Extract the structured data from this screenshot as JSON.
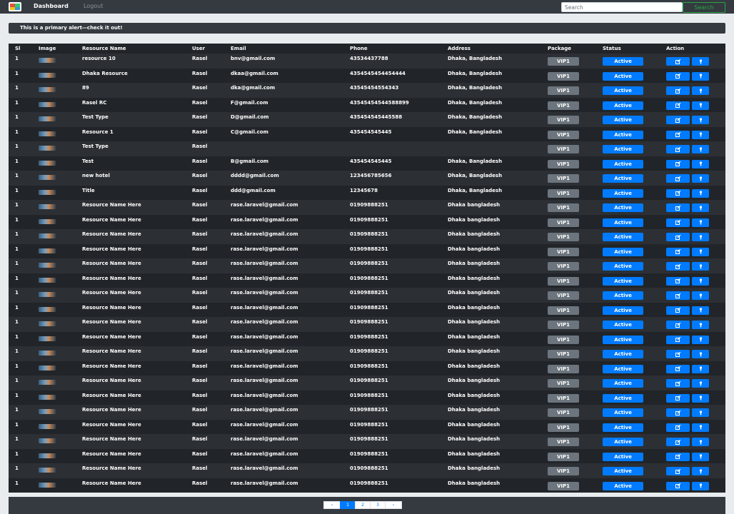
{
  "navbar": {
    "dashboard_label": "Dashboard",
    "logout_label": "Logout",
    "search_placeholder": "Search",
    "search_button": "Search"
  },
  "alert": {
    "text": "This is a primary alert—check it out!"
  },
  "table": {
    "headers": [
      "Sl",
      "Image",
      "Resource Name",
      "User",
      "Email",
      "Phone",
      "Address",
      "Package",
      "Status",
      "Action"
    ],
    "rows": [
      {
        "sl": "1",
        "name": "resource 10",
        "user": "Rasel",
        "email": "bnv@gmail.com",
        "phone": "43534437788",
        "address": "Dhaka, Bangladesh",
        "package": "VIP1",
        "status": "Active"
      },
      {
        "sl": "1",
        "name": "Dhaka Resource",
        "user": "Rasel",
        "email": "dkaa@gmail.com",
        "phone": "4354545454454444",
        "address": "Dhaka, Bangladesh",
        "package": "VIP1",
        "status": "Active"
      },
      {
        "sl": "1",
        "name": "89",
        "user": "Rasel",
        "email": "dka@gmail.com",
        "phone": "43545454554343",
        "address": "Dhaka, Bangladesh",
        "package": "VIP1",
        "status": "Active"
      },
      {
        "sl": "1",
        "name": "Rasel RC",
        "user": "Rasel",
        "email": "F@gmail.com",
        "phone": "43545454544588899",
        "address": "Dhaka, Bangladesh",
        "package": "VIP1",
        "status": "Active"
      },
      {
        "sl": "1",
        "name": "Test Type",
        "user": "Rasel",
        "email": "D@gmail.com",
        "phone": "435454545445588",
        "address": "Dhaka, Bangladesh",
        "package": "VIP1",
        "status": "Active"
      },
      {
        "sl": "1",
        "name": "Resource 1",
        "user": "Rasel",
        "email": "C@gmail.com",
        "phone": "435454545445",
        "address": "Dhaka, Bangladesh",
        "package": "VIP1",
        "status": "Active"
      },
      {
        "sl": "1",
        "name": "Test Type",
        "user": "Rasel",
        "email": "",
        "phone": "",
        "address": "",
        "package": "VIP1",
        "status": "Active"
      },
      {
        "sl": "1",
        "name": "Test",
        "user": "Rasel",
        "email": "B@gmail.com",
        "phone": "435454545445",
        "address": "Dhaka, Bangladesh",
        "package": "VIP1",
        "status": "Active"
      },
      {
        "sl": "1",
        "name": "new hotel",
        "user": "Rasel",
        "email": "dddd@gmail.com",
        "phone": "123456785656",
        "address": "Dhaka, Bangladesh",
        "package": "VIP1",
        "status": "Active"
      },
      {
        "sl": "1",
        "name": "Title",
        "user": "Rasel",
        "email": "ddd@gmail.com",
        "phone": "12345678",
        "address": "Dhaka, Bangladesh",
        "package": "VIP1",
        "status": "Active"
      },
      {
        "sl": "1",
        "name": "Resource Name Here",
        "user": "Rasel",
        "email": "rase.laravel@gmail.com",
        "phone": "01909888251",
        "address": "Dhaka bangladesh",
        "package": "VIP1",
        "status": "Active"
      },
      {
        "sl": "1",
        "name": "Resource Name Here",
        "user": "Rasel",
        "email": "rase.laravel@gmail.com",
        "phone": "01909888251",
        "address": "Dhaka bangladesh",
        "package": "VIP1",
        "status": "Active"
      },
      {
        "sl": "1",
        "name": "Resource Name Here",
        "user": "Rasel",
        "email": "rase.laravel@gmail.com",
        "phone": "01909888251",
        "address": "Dhaka bangladesh",
        "package": "VIP1",
        "status": "Active"
      },
      {
        "sl": "1",
        "name": "Resource Name Here",
        "user": "Rasel",
        "email": "rase.laravel@gmail.com",
        "phone": "01909888251",
        "address": "Dhaka bangladesh",
        "package": "VIP1",
        "status": "Active"
      },
      {
        "sl": "1",
        "name": "Resource Name Here",
        "user": "Rasel",
        "email": "rase.laravel@gmail.com",
        "phone": "01909888251",
        "address": "Dhaka bangladesh",
        "package": "VIP1",
        "status": "Active"
      },
      {
        "sl": "1",
        "name": "Resource Name Here",
        "user": "Rasel",
        "email": "rase.laravel@gmail.com",
        "phone": "01909888251",
        "address": "Dhaka bangladesh",
        "package": "VIP1",
        "status": "Active"
      },
      {
        "sl": "1",
        "name": "Resource Name Here",
        "user": "Rasel",
        "email": "rase.laravel@gmail.com",
        "phone": "01909888251",
        "address": "Dhaka bangladesh",
        "package": "VIP1",
        "status": "Active"
      },
      {
        "sl": "1",
        "name": "Resource Name Here",
        "user": "Rasel",
        "email": "rase.laravel@gmail.com",
        "phone": "01909888251",
        "address": "Dhaka bangladesh",
        "package": "VIP1",
        "status": "Active"
      },
      {
        "sl": "1",
        "name": "Resource Name Here",
        "user": "Rasel",
        "email": "rase.laravel@gmail.com",
        "phone": "01909888251",
        "address": "Dhaka bangladesh",
        "package": "VIP1",
        "status": "Active"
      },
      {
        "sl": "1",
        "name": "Resource Name Here",
        "user": "Rasel",
        "email": "rase.laravel@gmail.com",
        "phone": "01909888251",
        "address": "Dhaka bangladesh",
        "package": "VIP1",
        "status": "Active"
      },
      {
        "sl": "1",
        "name": "Resource Name Here",
        "user": "Rasel",
        "email": "rase.laravel@gmail.com",
        "phone": "01909888251",
        "address": "Dhaka bangladesh",
        "package": "VIP1",
        "status": "Active"
      },
      {
        "sl": "1",
        "name": "Resource Name Here",
        "user": "Rasel",
        "email": "rase.laravel@gmail.com",
        "phone": "01909888251",
        "address": "Dhaka bangladesh",
        "package": "VIP1",
        "status": "Active"
      },
      {
        "sl": "1",
        "name": "Resource Name Here",
        "user": "Rasel",
        "email": "rase.laravel@gmail.com",
        "phone": "01909888251",
        "address": "Dhaka bangladesh",
        "package": "VIP1",
        "status": "Active"
      },
      {
        "sl": "1",
        "name": "Resource Name Here",
        "user": "Rasel",
        "email": "rase.laravel@gmail.com",
        "phone": "01909888251",
        "address": "Dhaka bangladesh",
        "package": "VIP1",
        "status": "Active"
      },
      {
        "sl": "1",
        "name": "Resource Name Here",
        "user": "Rasel",
        "email": "rase.laravel@gmail.com",
        "phone": "01909888251",
        "address": "Dhaka bangladesh",
        "package": "VIP1",
        "status": "Active"
      },
      {
        "sl": "1",
        "name": "Resource Name Here",
        "user": "Rasel",
        "email": "rase.laravel@gmail.com",
        "phone": "01909888251",
        "address": "Dhaka bangladesh",
        "package": "VIP1",
        "status": "Active"
      },
      {
        "sl": "1",
        "name": "Resource Name Here",
        "user": "Rasel",
        "email": "rase.laravel@gmail.com",
        "phone": "01909888251",
        "address": "Dhaka bangladesh",
        "package": "VIP1",
        "status": "Active"
      },
      {
        "sl": "1",
        "name": "Resource Name Here",
        "user": "Rasel",
        "email": "rase.laravel@gmail.com",
        "phone": "01909888251",
        "address": "Dhaka bangladesh",
        "package": "VIP1",
        "status": "Active"
      },
      {
        "sl": "1",
        "name": "Resource Name Here",
        "user": "Rasel",
        "email": "rase.laravel@gmail.com",
        "phone": "01909888251",
        "address": "Dhaka bangladesh",
        "package": "VIP1",
        "status": "Active"
      },
      {
        "sl": "1",
        "name": "Resource Name Here",
        "user": "Rasel",
        "email": "rase.laravel@gmail.com",
        "phone": "01909888251",
        "address": "Dhaka bangladesh",
        "package": "VIP1",
        "status": "Active"
      }
    ],
    "edit_icon": "edit-icon",
    "view_icon": "view-icon"
  },
  "pagination": {
    "prev": "‹",
    "pages": [
      "1",
      "2",
      "3"
    ],
    "active_page": "1",
    "next": "›"
  },
  "colors": {
    "primary": "#007bff",
    "secondary": "#6c757d",
    "success": "#28a745",
    "dark": "#343a40",
    "table_bg": "#212529"
  }
}
